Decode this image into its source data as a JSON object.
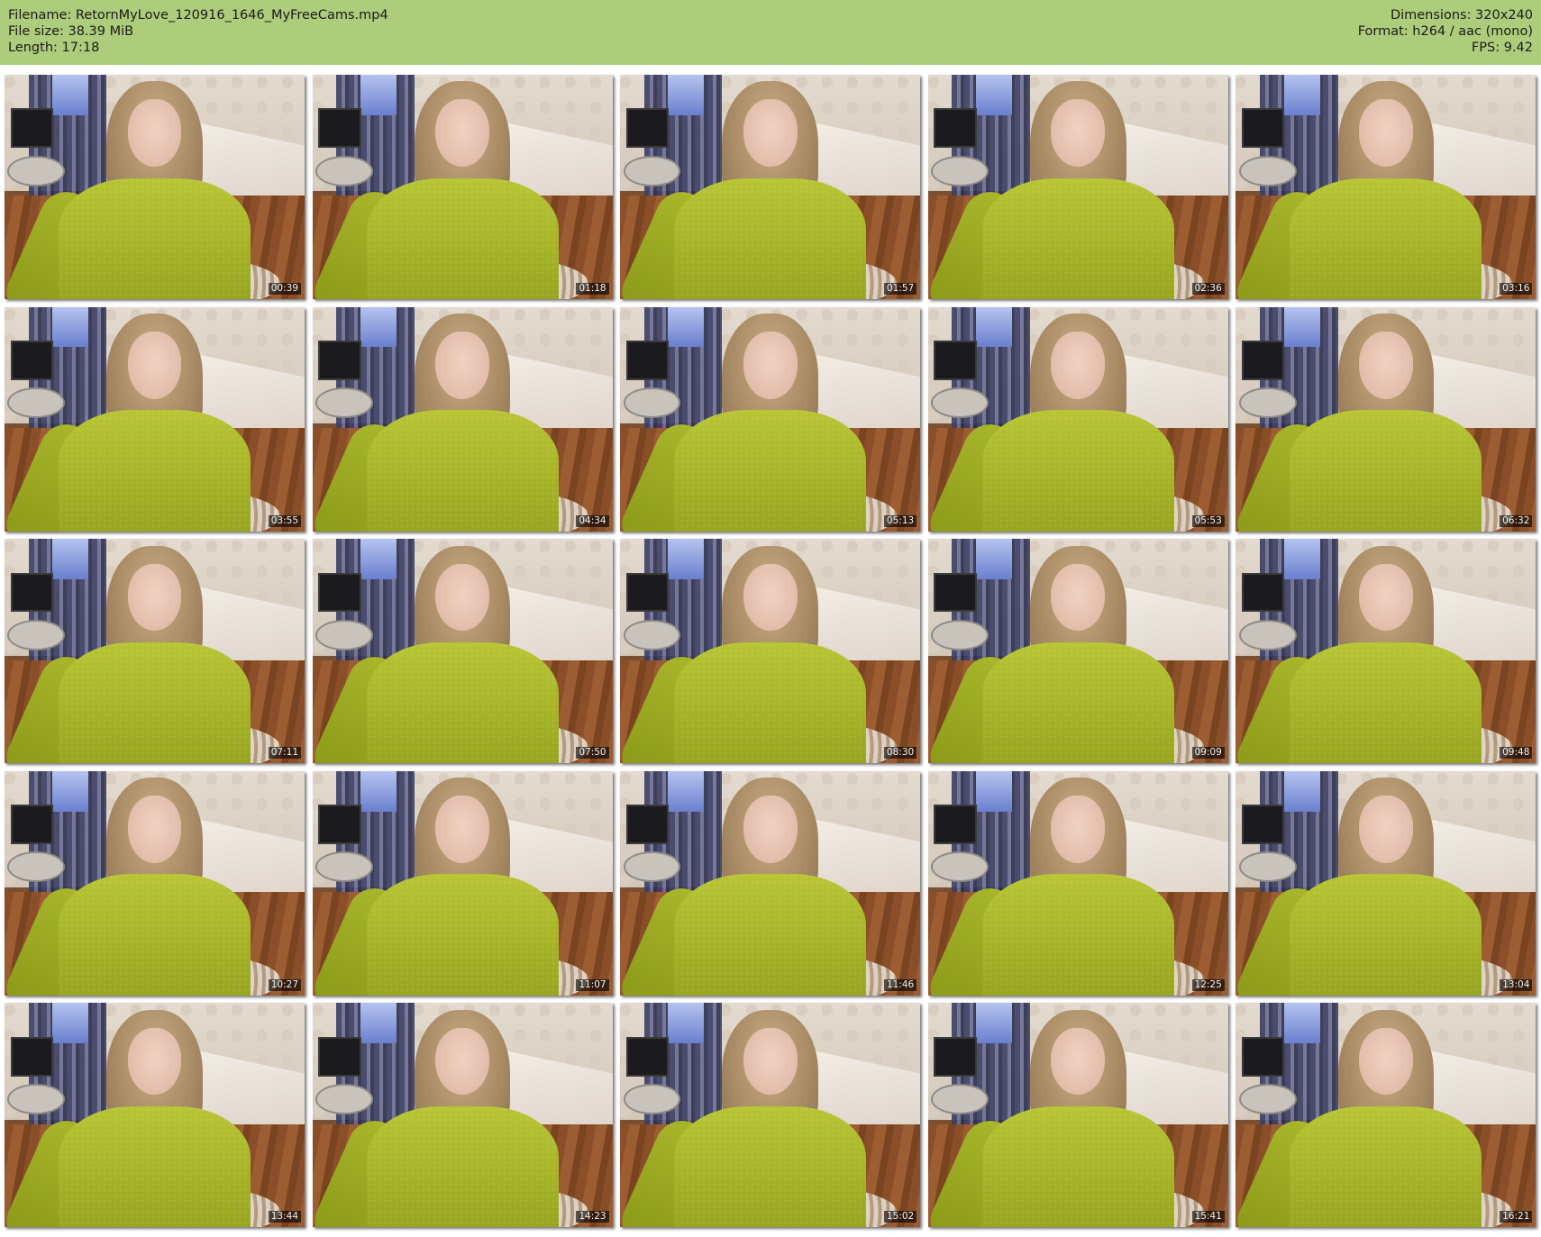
{
  "header": {
    "filename": "Filename: RetornMyLove_120916_1646_MyFreeCams.mp4",
    "file_size": "File size: 38.39 MiB",
    "length": "Length: 17:18",
    "dimensions": "Dimensions: 320x240",
    "format": "Format: h264 / aac (mono)",
    "fps": "FPS: 9.42"
  },
  "thumbnails": [
    "00:39",
    "01:18",
    "01:57",
    "02:36",
    "03:16",
    "03:55",
    "04:34",
    "05:13",
    "05:53",
    "06:32",
    "07:11",
    "07:50",
    "08:30",
    "09:09",
    "09:48",
    "10:27",
    "11:07",
    "11:46",
    "12:25",
    "13:04",
    "13:44",
    "14:23",
    "15:02",
    "15:41",
    "16:21"
  ]
}
